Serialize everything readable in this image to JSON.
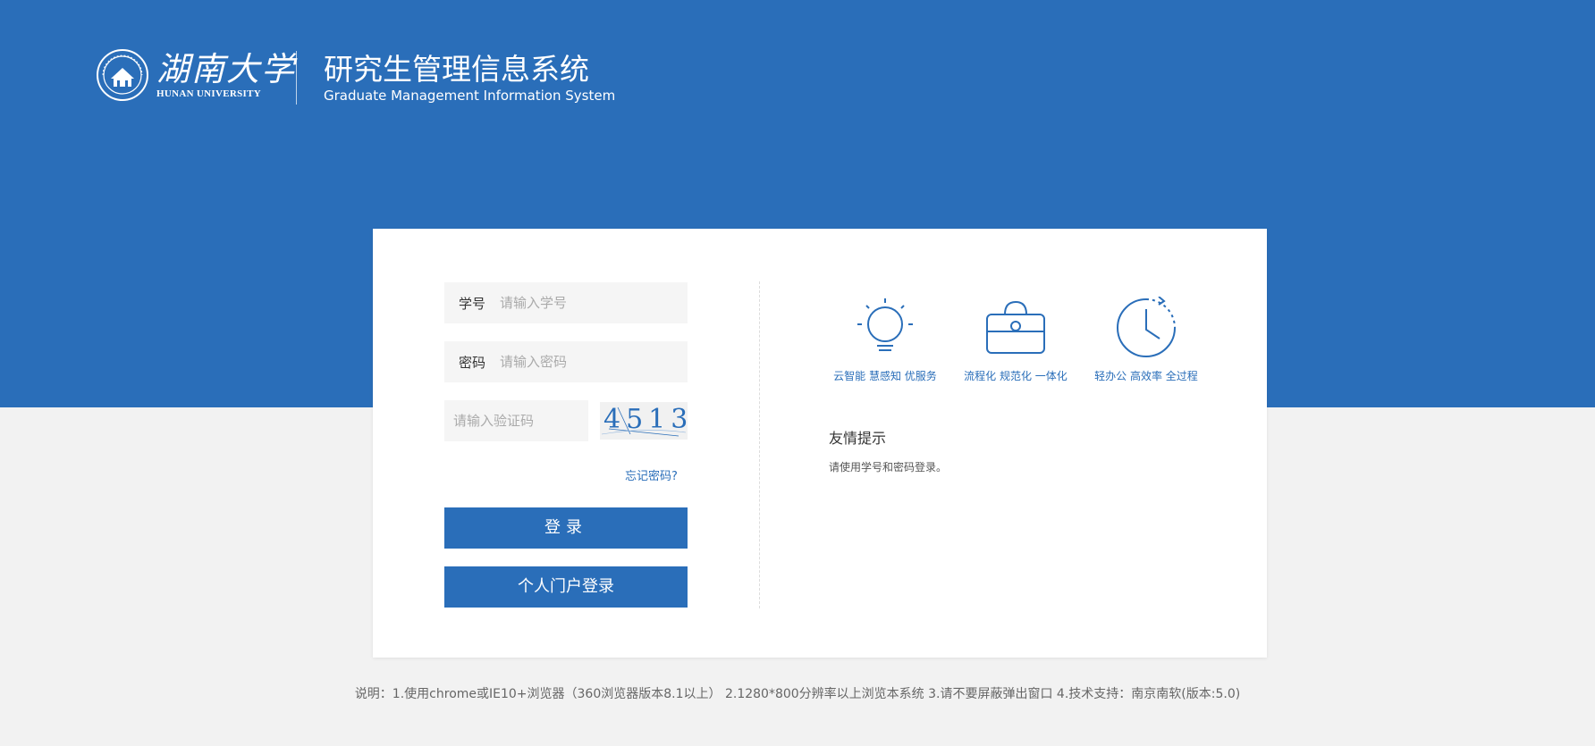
{
  "header": {
    "logo_cn": "湖南大学",
    "logo_en": "HUNAN UNIVERSITY",
    "title_cn": "研究生管理信息系统",
    "title_en": "Graduate Management Information System"
  },
  "login": {
    "student_id_label": "学号",
    "student_id_placeholder": "请输入学号",
    "password_label": "密码",
    "password_placeholder": "请输入密码",
    "captcha_placeholder": "请输入验证码",
    "captcha_code": "4513",
    "forgot_password": "忘记密码?",
    "login_button": "登录",
    "portal_button": "个人门户登录"
  },
  "features": [
    {
      "icon": "lightbulb-icon",
      "label": "云智能 慧感知 优服务"
    },
    {
      "icon": "briefcase-icon",
      "label": "流程化 规范化 一体化"
    },
    {
      "icon": "clock-icon",
      "label": "轻办公 高效率 全过程"
    }
  ],
  "tips": {
    "title": "友情提示",
    "text": "请使用学号和密码登录。"
  },
  "footer_note": "说明：1.使用chrome或IE10+浏览器（360浏览器版本8.1以上） 2.1280*800分辨率以上浏览本系统 3.请不要屏蔽弹出窗口 4.技术支持：南京南软(版本:5.0)",
  "colors": {
    "brand_blue": "#2a6eb9",
    "page_background": "#f2f2f2",
    "card_background": "#ffffff"
  }
}
